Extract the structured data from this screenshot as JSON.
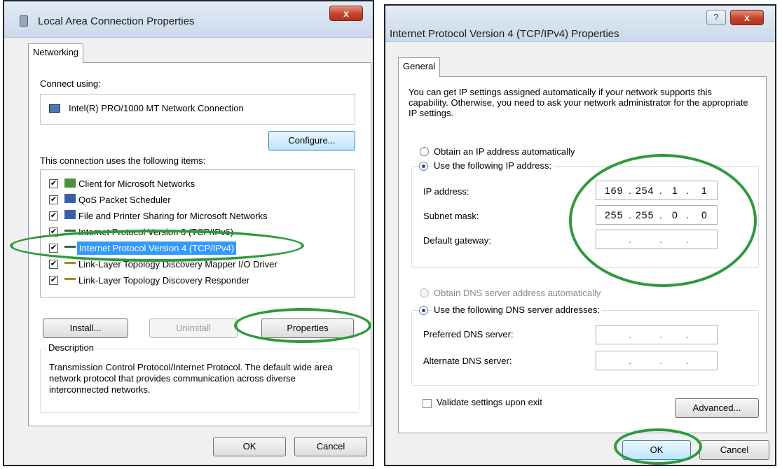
{
  "left_dialog": {
    "title": "Local Area Connection Properties",
    "close_label": "x",
    "tab": "Networking",
    "connect_using_label": "Connect using:",
    "adapter_name": "Intel(R) PRO/1000 MT Network Connection",
    "configure_label": "Configure...",
    "items_label": "This connection uses the following items:",
    "items": [
      {
        "label": "Client for Microsoft Networks",
        "checked": true,
        "icon": "network-client-icon"
      },
      {
        "label": "QoS Packet Scheduler",
        "checked": true,
        "icon": "service-icon"
      },
      {
        "label": "File and Printer Sharing for Microsoft Networks",
        "checked": true,
        "icon": "service-icon"
      },
      {
        "label": "Internet Protocol Version 6 (TCP/IPv6)",
        "checked": true,
        "icon": "protocol-icon"
      },
      {
        "label": "Internet Protocol Version 4 (TCP/IPv4)",
        "checked": true,
        "icon": "protocol-icon",
        "selected": true
      },
      {
        "label": "Link-Layer Topology Discovery Mapper I/O Driver",
        "checked": true,
        "icon": "protocol-icon"
      },
      {
        "label": "Link-Layer Topology Discovery Responder",
        "checked": true,
        "icon": "protocol-icon"
      }
    ],
    "install_label": "Install...",
    "uninstall_label": "Uninstall",
    "properties_label": "Properties",
    "description_title": "Description",
    "description_text": "Transmission Control Protocol/Internet Protocol. The default wide area network protocol that provides communication across diverse interconnected networks.",
    "ok_label": "OK",
    "cancel_label": "Cancel"
  },
  "right_dialog": {
    "title": "Internet Protocol Version 4 (TCP/IPv4) Properties",
    "help_label": "?",
    "close_label": "x",
    "tab": "General",
    "intro_text": "You can get IP settings assigned automatically if your network supports this capability. Otherwise, you need to ask your network administrator for the appropriate IP settings.",
    "obtain_ip_auto_label": "Obtain an IP address automatically",
    "use_following_ip_label": "Use the following IP address:",
    "ip_address_label": "IP address:",
    "ip_address_value": [
      "169",
      "254",
      "1",
      "1"
    ],
    "subnet_mask_label": "Subnet mask:",
    "subnet_mask_value": [
      "255",
      "255",
      "0",
      "0"
    ],
    "default_gateway_label": "Default gateway:",
    "obtain_dns_auto_label": "Obtain DNS server address automatically",
    "use_following_dns_label": "Use the following DNS server addresses:",
    "preferred_dns_label": "Preferred DNS server:",
    "alternate_dns_label": "Alternate DNS server:",
    "validate_label": "Validate settings upon exit",
    "advanced_label": "Advanced...",
    "ok_label": "OK",
    "cancel_label": "Cancel"
  },
  "colors": {
    "highlight_ellipse": "#2e9a3c",
    "selection": "#3399ff"
  }
}
